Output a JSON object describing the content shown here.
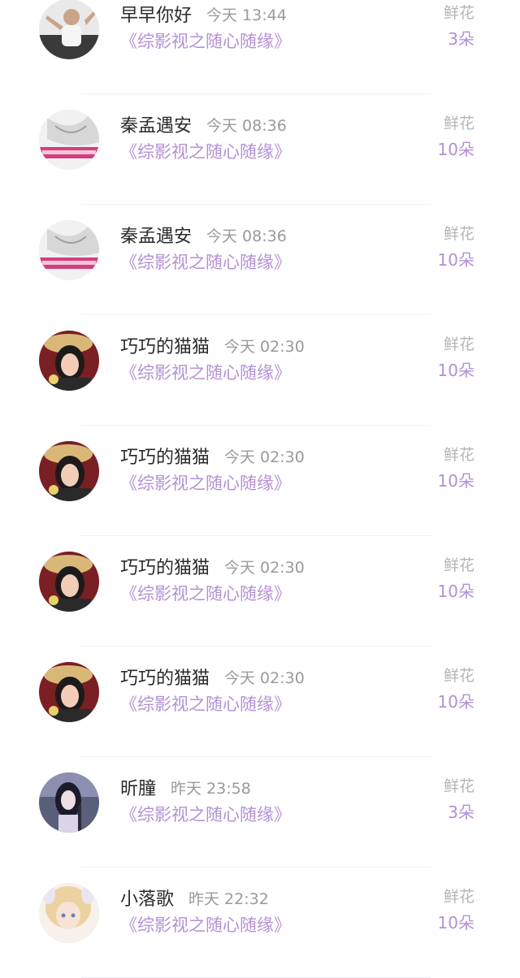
{
  "gifts": [
    {
      "user": "早早你好",
      "time": "今天 13:44",
      "book": "《综影视之随心随缘》",
      "gift": "鲜花",
      "count": "3朵",
      "avatar": "avatar-man"
    },
    {
      "user": "秦孟遇安",
      "time": "今天 08:36",
      "book": "《综影视之随心随缘》",
      "gift": "鲜花",
      "count": "10朵",
      "avatar": "avatar-sketch"
    },
    {
      "user": "秦孟遇安",
      "time": "今天 08:36",
      "book": "《综影视之随心随缘》",
      "gift": "鲜花",
      "count": "10朵",
      "avatar": "avatar-sketch"
    },
    {
      "user": "巧巧的猫猫",
      "time": "今天 02:30",
      "book": "《综影视之随心随缘》",
      "gift": "鲜花",
      "count": "10朵",
      "avatar": "avatar-hat-girl"
    },
    {
      "user": "巧巧的猫猫",
      "time": "今天 02:30",
      "book": "《综影视之随心随缘》",
      "gift": "鲜花",
      "count": "10朵",
      "avatar": "avatar-hat-girl"
    },
    {
      "user": "巧巧的猫猫",
      "time": "今天 02:30",
      "book": "《综影视之随心随缘》",
      "gift": "鲜花",
      "count": "10朵",
      "avatar": "avatar-hat-girl"
    },
    {
      "user": "巧巧的猫猫",
      "time": "今天 02:30",
      "book": "《综影视之随心随缘》",
      "gift": "鲜花",
      "count": "10朵",
      "avatar": "avatar-hat-girl"
    },
    {
      "user": "昕朣",
      "time": "昨天 23:58",
      "book": "《综影视之随心随缘》",
      "gift": "鲜花",
      "count": "3朵",
      "avatar": "avatar-anime-dark"
    },
    {
      "user": "小落歌",
      "time": "昨天 22:32",
      "book": "《综影视之随心随缘》",
      "gift": "鲜花",
      "count": "10朵",
      "avatar": "avatar-anime-blonde"
    }
  ],
  "colors": {
    "book_title": "#b390d4",
    "gift_count": "#b390d4",
    "gift_type": "#b5b5b5",
    "user_name": "#2a2a2a",
    "time": "#9a9a9a"
  }
}
